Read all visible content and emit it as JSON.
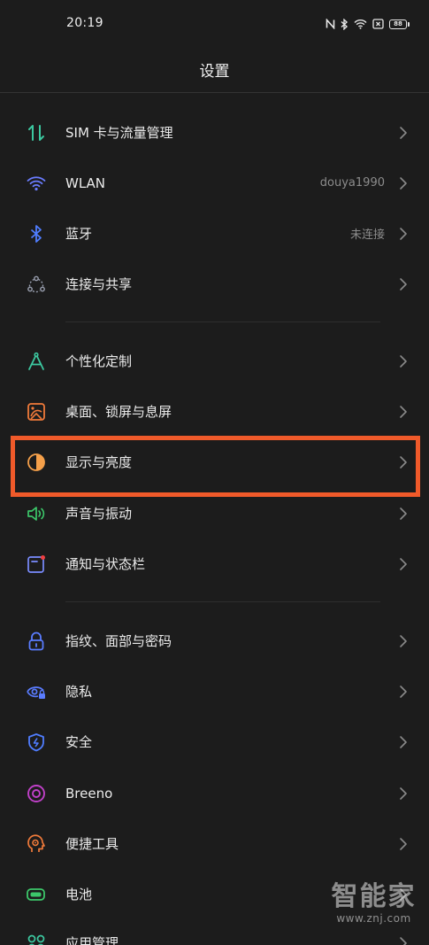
{
  "status_bar": {
    "time": "20:19",
    "battery": "88",
    "icons": [
      "nfc-icon",
      "bluetooth-icon",
      "wifi-icon",
      "sim-off-icon",
      "battery-icon"
    ]
  },
  "page": {
    "title": "设置"
  },
  "settings": [
    {
      "label": "SIM 卡与流量管理",
      "value": "",
      "icon": "sim-data-icon",
      "color": "#3cc8a0"
    },
    {
      "label": "WLAN",
      "value": "douya1990",
      "icon": "wifi-icon",
      "color": "#6a7cff"
    },
    {
      "label": "蓝牙",
      "value": "未连接",
      "icon": "bluetooth-icon",
      "color": "#4f7dff"
    },
    {
      "label": "连接与共享",
      "value": "",
      "icon": "share-connect-icon",
      "color": "#9aa0b0"
    },
    {
      "label": "个性化定制",
      "value": "",
      "icon": "compass-icon",
      "color": "#3cc8a0"
    },
    {
      "label": "桌面、锁屏与息屏",
      "value": "",
      "icon": "wallpaper-icon",
      "color": "#f07a3a"
    },
    {
      "label": "显示与亮度",
      "value": "",
      "icon": "brightness-icon",
      "color": "#f5a04a"
    },
    {
      "label": "声音与振动",
      "value": "",
      "icon": "speaker-icon",
      "color": "#3cc86a"
    },
    {
      "label": "通知与状态栏",
      "value": "",
      "icon": "notification-icon",
      "color": "#7a8cff"
    },
    {
      "label": "指纹、面部与密码",
      "value": "",
      "icon": "lock-icon",
      "color": "#5a7cff"
    },
    {
      "label": "隐私",
      "value": "",
      "icon": "privacy-eye-icon",
      "color": "#5a7cff"
    },
    {
      "label": "安全",
      "value": "",
      "icon": "shield-icon",
      "color": "#4f7dff"
    },
    {
      "label": "Breeno",
      "value": "",
      "icon": "breeno-icon",
      "color": "#c040c8"
    },
    {
      "label": "便捷工具",
      "value": "",
      "icon": "tools-icon",
      "color": "#f07a3a"
    },
    {
      "label": "电池",
      "value": "",
      "icon": "battery-setting-icon",
      "color": "#3cc86a"
    },
    {
      "label": "应用管理",
      "value": "",
      "icon": "apps-icon",
      "color": "#3cc8a0"
    }
  ],
  "highlight": {
    "color": "#f05a2a",
    "target": "显示与亮度"
  },
  "watermark": {
    "logo": "智能家",
    "url": "www.znj.com"
  }
}
